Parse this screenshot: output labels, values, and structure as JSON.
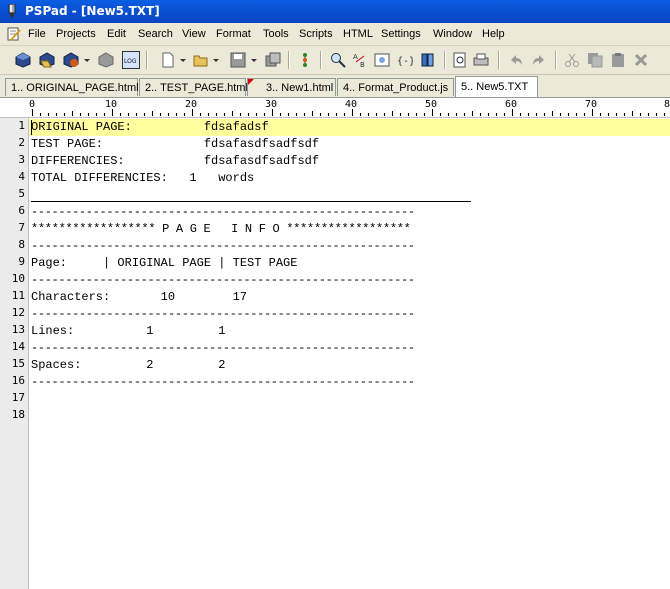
{
  "window": {
    "title": "PSPad - [New5.TXT]",
    "title_bar_color": "#0b4fd0"
  },
  "menu": [
    "File",
    "Projects",
    "Edit",
    "Search",
    "View",
    "Format",
    "Tools",
    "Scripts",
    "HTML",
    "Settings",
    "Window",
    "Help"
  ],
  "toolbar_icons": [
    "new-project-icon",
    "open-project-icon",
    "save-project-icon",
    "close-project-icon",
    "log-icon",
    "new-file-icon",
    "open-file-icon",
    "save-icon",
    "save-all-icon",
    "tree-icon",
    "search-icon",
    "replace-icon",
    "preview-icon",
    "code-icon",
    "books-icon",
    "print-preview-icon",
    "print-icon",
    "undo-icon",
    "redo-icon",
    "cut-icon",
    "copy-icon",
    "paste-icon",
    "delete-icon"
  ],
  "tabs": [
    {
      "label": "1.. ORIGINAL_PAGE.html",
      "active": false,
      "modified": false
    },
    {
      "label": "2.. TEST_PAGE.html",
      "active": false,
      "modified": false
    },
    {
      "label": "3.. New1.html",
      "active": false,
      "modified": true
    },
    {
      "label": "4.. Format_Product.js",
      "active": false,
      "modified": false
    },
    {
      "label": "5.. New5.TXT",
      "active": true,
      "modified": false
    }
  ],
  "ruler": {
    "labels": [
      "0",
      "10",
      "20",
      "30",
      "40",
      "50",
      "60",
      "70",
      "8"
    ]
  },
  "editor": {
    "current_line": 1,
    "highlight_color": "#ffffa0",
    "line_numbers": [
      "1",
      "2",
      "3",
      "4",
      "5",
      "6",
      "7",
      "8",
      "9",
      "10",
      "11",
      "12",
      "13",
      "14",
      "15",
      "16",
      "17",
      "18"
    ],
    "lines": [
      "ORIGINAL PAGE:          fdsafadsf",
      "TEST PAGE:              fdsafasdfsadfsdf",
      "DIFFERENCIES:           fdsafasdfsadfsdf",
      "TOTAL DIFFERENCIES:   1   words",
      "",
      "--------------------------------------------------------",
      "****************** P A G E   I N F O ******************",
      "--------------------------------------------------------",
      "Page:     | ORIGINAL PAGE | TEST PAGE",
      "--------------------------------------------------------",
      "Characters:       10        17",
      "--------------------------------------------------------",
      "Lines:          1         1",
      "--------------------------------------------------------",
      "Spaces:         2         2",
      "--------------------------------------------------------",
      "",
      ""
    ]
  }
}
